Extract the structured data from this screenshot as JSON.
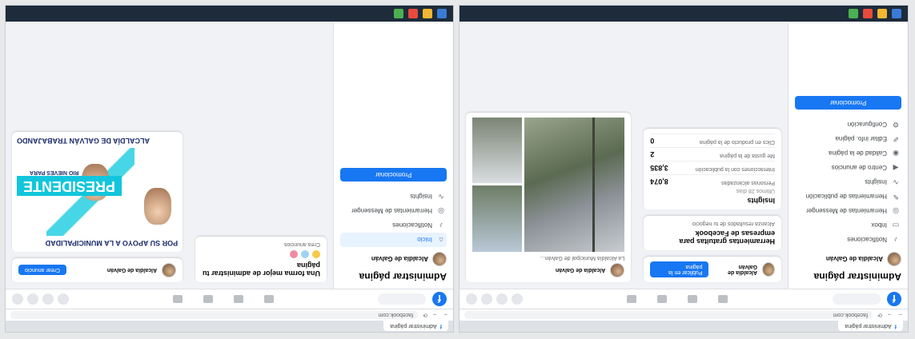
{
  "browser": {
    "tab_label": "Administrar página",
    "url": "facebook.com"
  },
  "left": {
    "sidebar": {
      "title": "Administrar página",
      "page_name": "Alcaldía de Galván",
      "items": [
        {
          "label": "Notificaciones",
          "icon": "bell-icon"
        },
        {
          "label": "Inbox",
          "icon": "chat-icon"
        },
        {
          "label": "Herramientas de Messenger",
          "icon": "messenger-icon"
        },
        {
          "label": "Herramientas de publicación",
          "icon": "pen-icon"
        },
        {
          "label": "Insights",
          "icon": "chart-icon"
        },
        {
          "label": "Centro de anuncios",
          "icon": "megaphone-icon"
        },
        {
          "label": "Calidad de la página",
          "icon": "shield-icon"
        },
        {
          "label": "Editar info. página",
          "icon": "edit-icon"
        },
        {
          "label": "Configuración",
          "icon": "gear-icon"
        }
      ],
      "promote_label": "Promocionar"
    },
    "insights_card": {
      "title": "Insights",
      "subtitle": "Últimos 28 días",
      "rows": [
        {
          "label": "Personas alcanzadas",
          "value": "8,074"
        },
        {
          "label": "Interacciones con la publicación",
          "value": "3,835"
        },
        {
          "label": "Me gusta de la página",
          "value": "2"
        },
        {
          "label": "Clics en producto de la página",
          "value": "0"
        }
      ]
    },
    "tools_card": {
      "title": "Herramientas gratuitas para empresas de Facebook",
      "text": "Alcanza resultados de tu negocio"
    },
    "post": {
      "author": "Alcaldía de Galván",
      "cta_label": "Publicar en la página",
      "caption": "La Alcaldía Municipal de Galván..."
    }
  },
  "right": {
    "sidebar": {
      "title": "Administrar página",
      "page_name": "Alcaldía de Galván",
      "items": [
        {
          "label": "Inicio",
          "icon": "home-icon"
        },
        {
          "label": "Notificaciones",
          "icon": "bell-icon"
        },
        {
          "label": "Herramientas de Messenger",
          "icon": "messenger-icon"
        },
        {
          "label": "Insights",
          "icon": "chart-icon"
        }
      ],
      "promote_label": "Promocionar"
    },
    "tip_card": {
      "title": "Una forma mejor de administrar tu página",
      "text": "Crea anuncios"
    },
    "post": {
      "author": "Alcaldía de Galván",
      "cta_label": "Crear anuncio"
    },
    "poster": {
      "line1": "POR SU APOYO A LA MUNICIPALIDAD",
      "band": "PRESIDENTE",
      "candidates": "RIO NIEVES PARA",
      "bottom": "ALCALDÍA DE GALVÁN TRABAJANDO"
    }
  },
  "colors": {
    "facebook_blue": "#1877f2",
    "poster_cyan": "#11c6dc"
  }
}
